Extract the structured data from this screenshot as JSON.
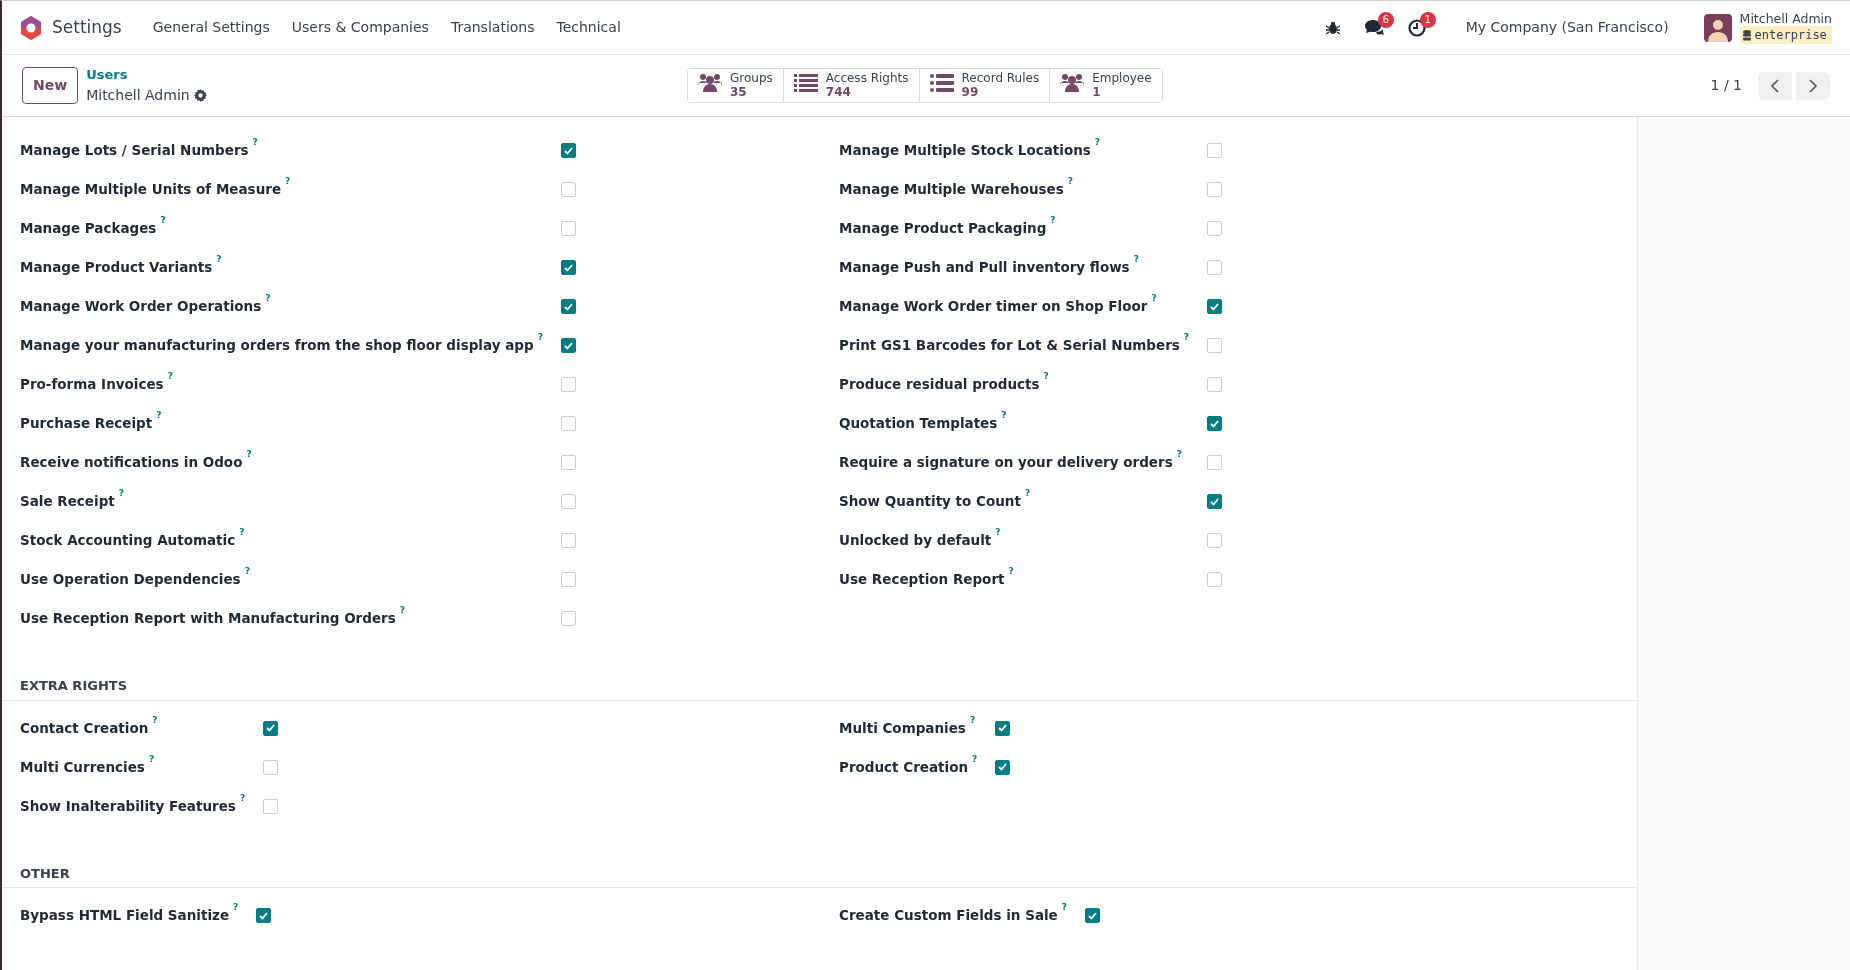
{
  "navbar": {
    "app_title": "Settings",
    "menu": [
      "General Settings",
      "Users & Companies",
      "Translations",
      "Technical"
    ],
    "messages_count": "6",
    "activities_count": "1",
    "company": "My Company (San Francisco)",
    "user_name": "Mitchell Admin",
    "database": "enterprise"
  },
  "control_panel": {
    "new_button": "New",
    "breadcrumb": "Users",
    "record_title": "Mitchell Admin",
    "stat_buttons": [
      {
        "kind": "group",
        "label": "Groups",
        "value": "35"
      },
      {
        "kind": "list",
        "label": "Access Rights",
        "value": "744"
      },
      {
        "kind": "bullets",
        "label": "Record Rules",
        "value": "99"
      },
      {
        "kind": "group",
        "label": "Employee",
        "value": "1"
      }
    ],
    "pager": "1 / 1"
  },
  "sections": [
    {
      "left": [
        {
          "label": "Manage Lots / Serial Numbers",
          "checked": true
        },
        {
          "label": "Manage Multiple Units of Measure",
          "checked": false
        },
        {
          "label": "Manage Packages",
          "checked": false
        },
        {
          "label": "Manage Product Variants",
          "checked": true
        },
        {
          "label": "Manage Work Order Operations",
          "checked": true
        },
        {
          "label": "Manage your manufacturing orders from the shop floor display app",
          "checked": true
        },
        {
          "label": "Pro-forma Invoices",
          "checked": false
        },
        {
          "label": "Purchase Receipt",
          "checked": false
        },
        {
          "label": "Receive notifications in Odoo",
          "checked": false
        },
        {
          "label": "Sale Receipt",
          "checked": false
        },
        {
          "label": "Stock Accounting Automatic",
          "checked": false
        },
        {
          "label": "Use Operation Dependencies",
          "checked": false
        },
        {
          "label": "Use Reception Report with Manufacturing Orders",
          "checked": false
        }
      ],
      "right": [
        {
          "label": "Manage Multiple Stock Locations",
          "checked": false
        },
        {
          "label": "Manage Multiple Warehouses",
          "checked": false
        },
        {
          "label": "Manage Product Packaging",
          "checked": false
        },
        {
          "label": "Manage Push and Pull inventory flows",
          "checked": false
        },
        {
          "label": "Manage Work Order timer on Shop Floor",
          "checked": true
        },
        {
          "label": "Print GS1 Barcodes for Lot & Serial Numbers",
          "checked": false
        },
        {
          "label": "Produce residual products",
          "checked": false
        },
        {
          "label": "Quotation Templates",
          "checked": true
        },
        {
          "label": "Require a signature on your delivery orders",
          "checked": false
        },
        {
          "label": "Show Quantity to Count",
          "checked": true
        },
        {
          "label": "Unlocked by default",
          "checked": false
        },
        {
          "label": "Use Reception Report",
          "checked": false
        }
      ]
    },
    {
      "title": "EXTRA RIGHTS",
      "left": [
        {
          "label": "Contact Creation",
          "checked": true
        },
        {
          "label": "Multi Currencies",
          "checked": false
        },
        {
          "label": "Show Inalterability Features",
          "checked": false
        }
      ],
      "right": [
        {
          "label": "Multi Companies",
          "checked": true
        },
        {
          "label": "Product Creation",
          "checked": true
        }
      ]
    },
    {
      "title": "OTHER",
      "left": [
        {
          "label": "Bypass HTML Field Sanitize",
          "checked": true
        }
      ],
      "right": [
        {
          "label": "Create Custom Fields in Sale",
          "checked": true
        }
      ]
    }
  ],
  "help_mark": "?"
}
